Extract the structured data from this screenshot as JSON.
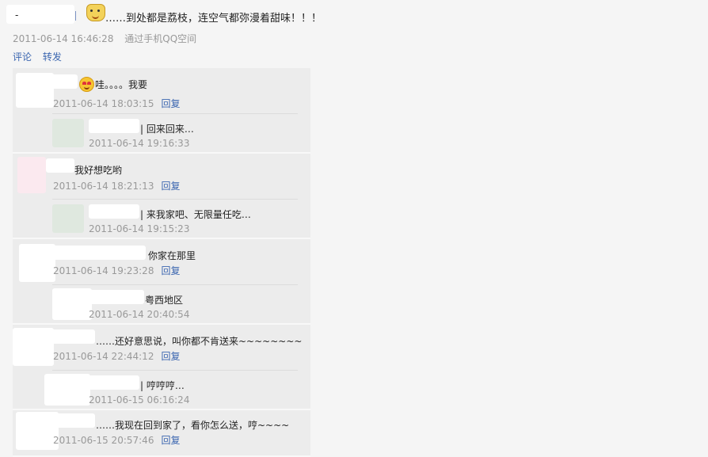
{
  "post": {
    "username_prefix": "-",
    "emoji": "crying-emoji",
    "text": "……到处都是荔枝，连空气都弥漫着甜味！！！",
    "time": "2011-06-14 16:46:28",
    "source": "通过手机QQ空间",
    "actions": [
      "评论",
      "转发"
    ]
  },
  "comments": [
    {
      "emoji": "heart-eyes-emoji",
      "text": "哇。。。。我要",
      "time": "2011-06-14 18:03:15",
      "reply_label": "回复",
      "reply": {
        "text": "| 回来回来…",
        "time": "2011-06-14 19:16:33"
      }
    },
    {
      "text": "我好想吃哟",
      "time": "2011-06-14 18:21:13",
      "reply_label": "回复",
      "reply": {
        "text": "| 来我家吧、无限量任吃…",
        "time": "2011-06-14 19:15:23"
      }
    },
    {
      "text": "你家在那里",
      "time": "2011-06-14 19:23:28",
      "reply_label": "回复",
      "reply": {
        "text": "粤西地区",
        "time": "2011-06-14 20:40:54"
      }
    },
    {
      "text": "……还好意思说，叫你都不肯送来~~~~~~~~",
      "time": "2011-06-14 22:44:12",
      "reply_label": "回复",
      "reply": {
        "text": "| 哼哼哼…",
        "time": "2011-06-15 06:16:24"
      }
    },
    {
      "text": "……我现在回到家了，看你怎么送，哼~~~~",
      "time": "2011-06-15 20:57:46",
      "reply_label": "回复"
    }
  ]
}
